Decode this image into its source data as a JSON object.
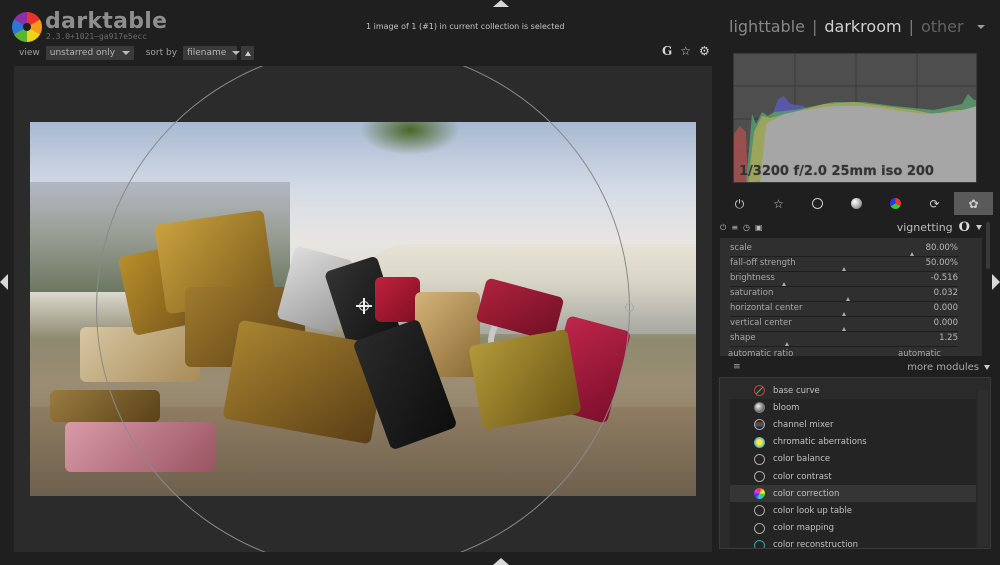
{
  "app": {
    "name": "darktable",
    "version": "2.3.0+1021~ga917e5ecc"
  },
  "header": {
    "status": "1 image of 1 (#1) in current collection is selected",
    "view_label": "view",
    "view_value": "unstarred only",
    "sort_label": "sort by",
    "sort_value": "filename",
    "icons": [
      "grouping-icon",
      "star-icon",
      "gear-icon"
    ],
    "grouping_glyph": "G",
    "star_glyph": "☆",
    "gear_glyph": "⚙"
  },
  "view_switcher": {
    "items": [
      {
        "label": "lighttable",
        "state": "inactive"
      },
      {
        "label": "darkroom",
        "state": "active"
      },
      {
        "label": "other",
        "state": "dim"
      }
    ],
    "separator": "|"
  },
  "histogram": {
    "exif": "1/3200 f/2.0 25mm iso 200"
  },
  "module_groups": {
    "tabs": [
      {
        "name": "active-modules",
        "glyph": "⏻"
      },
      {
        "name": "favorites",
        "glyph": "☆"
      },
      {
        "name": "basic",
        "glyph": ""
      },
      {
        "name": "tone",
        "glyph": ""
      },
      {
        "name": "color",
        "glyph": ""
      },
      {
        "name": "correct",
        "glyph": "⟳"
      },
      {
        "name": "effect",
        "glyph": "✿"
      }
    ],
    "active_index": 6
  },
  "module": {
    "title": "vignetting",
    "preset_glyph": "O",
    "header_icons": {
      "power": "⏻",
      "presets": "≡",
      "reset": "◷",
      "multi": "▣"
    },
    "sliders": [
      {
        "label": "scale",
        "value": "80.00%",
        "position": 0.8
      },
      {
        "label": "fall-off strength",
        "value": "50.00%",
        "position": 0.5
      },
      {
        "label": "brightness",
        "value": "-0.516",
        "position": 0.24
      },
      {
        "label": "saturation",
        "value": "0.032",
        "position": 0.52
      },
      {
        "label": "horizontal center",
        "value": "0.000",
        "position": 0.5
      },
      {
        "label": "vertical center",
        "value": "0.000",
        "position": 0.5
      },
      {
        "label": "shape",
        "value": "1.25",
        "position": 0.25
      }
    ],
    "auto_ratio": {
      "label": "automatic ratio",
      "value": "automatic"
    }
  },
  "more_modules": {
    "label": "more modules",
    "menu_glyph": "≡",
    "items": [
      {
        "label": "base curve",
        "icon": "basecurve"
      },
      {
        "label": "bloom",
        "icon": "bloom"
      },
      {
        "label": "channel mixer",
        "icon": "mixer"
      },
      {
        "label": "chromatic aberrations",
        "icon": "chroma"
      },
      {
        "label": "color balance",
        "icon": "circle"
      },
      {
        "label": "color contrast",
        "icon": "circle"
      },
      {
        "label": "color correction",
        "icon": "corr"
      },
      {
        "label": "color look up table",
        "icon": "circle"
      },
      {
        "label": "color mapping",
        "icon": "circle"
      },
      {
        "label": "color reconstruction",
        "icon": "recon"
      }
    ]
  }
}
